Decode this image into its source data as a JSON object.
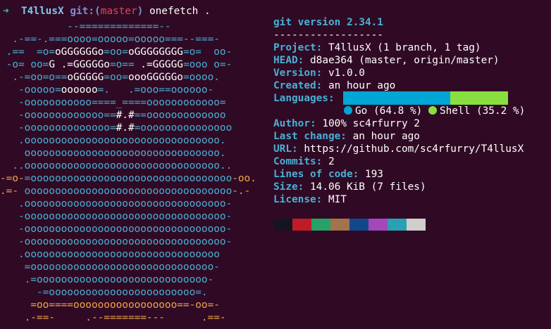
{
  "prompt": {
    "arrow": "➜",
    "directory": "T4llusX",
    "git_label": "git:(",
    "branch": "master",
    "git_close": ")",
    "command": "onefetch ."
  },
  "ascii_art": [
    [
      {
        "t": "           --=============--",
        "c": "cyan"
      }
    ],
    [
      {
        "t": "  .-==-.===oooo=ooooo=ooooo===--===-",
        "c": "cyan"
      }
    ],
    [
      {
        "t": " .==  =o=",
        "c": "cyan"
      },
      {
        "t": "oGGGGGGo",
        "c": "white"
      },
      {
        "t": "=oo=",
        "c": "cyan"
      },
      {
        "t": "oGGGGGGGG",
        "c": "white"
      },
      {
        "t": "=o=  oo-",
        "c": "cyan"
      }
    ],
    [
      {
        "t": " -o= oo=",
        "c": "cyan"
      },
      {
        "t": "G .=GGGGGo",
        "c": "white"
      },
      {
        "t": "=o== ",
        "c": "cyan"
      },
      {
        "t": ".=GGGGG",
        "c": "white"
      },
      {
        "t": "=ooo o=-",
        "c": "cyan"
      }
    ],
    [
      {
        "t": "  .-=oo=o==",
        "c": "cyan"
      },
      {
        "t": "oGGGGG",
        "c": "white"
      },
      {
        "t": "=oo=",
        "c": "cyan"
      },
      {
        "t": "oooGGGGGo",
        "c": "white"
      },
      {
        "t": "=oooo.",
        "c": "cyan"
      }
    ],
    [
      {
        "t": "   -ooooo=",
        "c": "cyan"
      },
      {
        "t": "oooooo",
        "c": "white"
      },
      {
        "t": "=.   .=ooo==oooooo-",
        "c": "cyan"
      }
    ],
    [
      {
        "t": "   -ooooooooooo====_====oooooooooooo=",
        "c": "cyan"
      }
    ],
    [
      {
        "t": "   -ooooooooooooo==",
        "c": "cyan"
      },
      {
        "t": "#.#",
        "c": "white"
      },
      {
        "t": "==ooooooooooooo",
        "c": "cyan"
      }
    ],
    [
      {
        "t": "   -oooooooooooooo=",
        "c": "cyan"
      },
      {
        "t": "#.#",
        "c": "white"
      },
      {
        "t": "=ooooooooooooooo",
        "c": "cyan"
      }
    ],
    [
      {
        "t": "   .oooooooooooooooooooooooooooooooo.",
        "c": "cyan"
      }
    ],
    [
      {
        "t": "    oooooooooooooooooooooooooooooooo.",
        "c": "cyan"
      }
    ],
    [
      {
        "t": "  ..oooooooooooooooooooooooooooooooo..",
        "c": "cyan"
      }
    ],
    [
      {
        "t": "-=o-",
        "c": "yellow"
      },
      {
        "t": "=ooooooooooooooooooooooooooooooooo",
        "c": "cyan"
      },
      {
        "t": "-oo.",
        "c": "yellow"
      }
    ],
    [
      {
        "t": ".=- ",
        "c": "yellow"
      },
      {
        "t": "oooooooooooooooooooooooooooooooooo",
        "c": "cyan"
      },
      {
        "t": "-.-",
        "c": "yellow"
      }
    ],
    [
      {
        "t": "   .ooooooooooooooooooooooooooooooooo-",
        "c": "cyan"
      }
    ],
    [
      {
        "t": "   -ooooooooooooooooooooooooooooooooo-",
        "c": "cyan"
      }
    ],
    [
      {
        "t": "   -ooooooooooooooooooooooooooooooooo-",
        "c": "cyan"
      }
    ],
    [
      {
        "t": "   -ooooooooooooooooooooooooooooooooo-",
        "c": "cyan"
      }
    ],
    [
      {
        "t": "   .oooooooooooooooooooooooooooooooo",
        "c": "cyan"
      }
    ],
    [
      {
        "t": "    =oooooooooooooooooooooooooooooo-",
        "c": "cyan"
      }
    ],
    [
      {
        "t": "    .=oooooooooooooooooooooooooooo-",
        "c": "cyan"
      }
    ],
    [
      {
        "t": "      -=oooooooooooooooooooooooo=.",
        "c": "cyan"
      }
    ],
    [
      {
        "t": "     =oo====ooooooooooooooooo==-",
        "c": "yellow"
      },
      {
        "t": "oo=-",
        "c": "yellow"
      }
    ],
    [
      {
        "t": "    .-==-     .--=======---      .==-",
        "c": "yellow"
      }
    ]
  ],
  "info": {
    "title": "git version 2.34.1",
    "separator": "------------------",
    "project_key": "Project:",
    "project_val": "T4llusX (1 branch, 1 tag)",
    "head_key": "HEAD:",
    "head_val": "d8ae364 (master, origin/master)",
    "version_key": "Version:",
    "version_val": "v1.0.0",
    "created_key": "Created:",
    "created_val": "an hour ago",
    "languages_key": "Languages:",
    "lang1_label": "Go (64.8 %)",
    "lang2_label": "Shell (35.2 %)",
    "author_key": "Author:",
    "author_val": "100% sc4rfurry 2",
    "lastchange_key": "Last change:",
    "lastchange_val": "an hour ago",
    "url_key": "URL:",
    "url_val": "https://github.com/sc4rfurry/T4llusX",
    "commits_key": "Commits:",
    "commits_val": "2",
    "loc_key": "Lines of code:",
    "loc_val": "193",
    "size_key": "Size:",
    "size_val": "14.06 KiB (7 files)",
    "license_key": "License:",
    "license_val": "MIT"
  },
  "languages": [
    {
      "name": "Go",
      "percent": 64.8,
      "color": "#00a6d6"
    },
    {
      "name": "Shell",
      "percent": 35.2,
      "color": "#89df3f"
    }
  ],
  "palette": [
    "#171421",
    "#c01c28",
    "#26a269",
    "#a2734c",
    "#12488b",
    "#a347ba",
    "#2aa1b3",
    "#d0cfcc"
  ],
  "colors": {
    "background": "#300a24",
    "cyan": "#49b0d4",
    "yellow": "#f0a64c",
    "prompt_green": "#4fbf8f",
    "branch_red": "#e0455a"
  }
}
